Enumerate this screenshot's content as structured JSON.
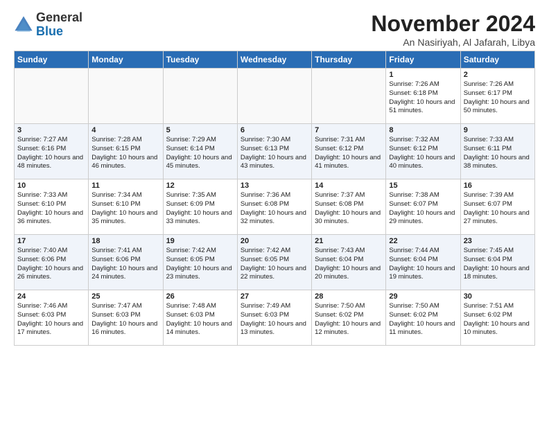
{
  "header": {
    "logo_general": "General",
    "logo_blue": "Blue",
    "month_title": "November 2024",
    "location": "An Nasiriyah, Al Jafarah, Libya"
  },
  "weekdays": [
    "Sunday",
    "Monday",
    "Tuesday",
    "Wednesday",
    "Thursday",
    "Friday",
    "Saturday"
  ],
  "weeks": [
    [
      {
        "day": "",
        "info": ""
      },
      {
        "day": "",
        "info": ""
      },
      {
        "day": "",
        "info": ""
      },
      {
        "day": "",
        "info": ""
      },
      {
        "day": "",
        "info": ""
      },
      {
        "day": "1",
        "info": "Sunrise: 7:26 AM\nSunset: 6:18 PM\nDaylight: 10 hours and 51 minutes."
      },
      {
        "day": "2",
        "info": "Sunrise: 7:26 AM\nSunset: 6:17 PM\nDaylight: 10 hours and 50 minutes."
      }
    ],
    [
      {
        "day": "3",
        "info": "Sunrise: 7:27 AM\nSunset: 6:16 PM\nDaylight: 10 hours and 48 minutes."
      },
      {
        "day": "4",
        "info": "Sunrise: 7:28 AM\nSunset: 6:15 PM\nDaylight: 10 hours and 46 minutes."
      },
      {
        "day": "5",
        "info": "Sunrise: 7:29 AM\nSunset: 6:14 PM\nDaylight: 10 hours and 45 minutes."
      },
      {
        "day": "6",
        "info": "Sunrise: 7:30 AM\nSunset: 6:13 PM\nDaylight: 10 hours and 43 minutes."
      },
      {
        "day": "7",
        "info": "Sunrise: 7:31 AM\nSunset: 6:12 PM\nDaylight: 10 hours and 41 minutes."
      },
      {
        "day": "8",
        "info": "Sunrise: 7:32 AM\nSunset: 6:12 PM\nDaylight: 10 hours and 40 minutes."
      },
      {
        "day": "9",
        "info": "Sunrise: 7:33 AM\nSunset: 6:11 PM\nDaylight: 10 hours and 38 minutes."
      }
    ],
    [
      {
        "day": "10",
        "info": "Sunrise: 7:33 AM\nSunset: 6:10 PM\nDaylight: 10 hours and 36 minutes."
      },
      {
        "day": "11",
        "info": "Sunrise: 7:34 AM\nSunset: 6:10 PM\nDaylight: 10 hours and 35 minutes."
      },
      {
        "day": "12",
        "info": "Sunrise: 7:35 AM\nSunset: 6:09 PM\nDaylight: 10 hours and 33 minutes."
      },
      {
        "day": "13",
        "info": "Sunrise: 7:36 AM\nSunset: 6:08 PM\nDaylight: 10 hours and 32 minutes."
      },
      {
        "day": "14",
        "info": "Sunrise: 7:37 AM\nSunset: 6:08 PM\nDaylight: 10 hours and 30 minutes."
      },
      {
        "day": "15",
        "info": "Sunrise: 7:38 AM\nSunset: 6:07 PM\nDaylight: 10 hours and 29 minutes."
      },
      {
        "day": "16",
        "info": "Sunrise: 7:39 AM\nSunset: 6:07 PM\nDaylight: 10 hours and 27 minutes."
      }
    ],
    [
      {
        "day": "17",
        "info": "Sunrise: 7:40 AM\nSunset: 6:06 PM\nDaylight: 10 hours and 26 minutes."
      },
      {
        "day": "18",
        "info": "Sunrise: 7:41 AM\nSunset: 6:06 PM\nDaylight: 10 hours and 24 minutes."
      },
      {
        "day": "19",
        "info": "Sunrise: 7:42 AM\nSunset: 6:05 PM\nDaylight: 10 hours and 23 minutes."
      },
      {
        "day": "20",
        "info": "Sunrise: 7:42 AM\nSunset: 6:05 PM\nDaylight: 10 hours and 22 minutes."
      },
      {
        "day": "21",
        "info": "Sunrise: 7:43 AM\nSunset: 6:04 PM\nDaylight: 10 hours and 20 minutes."
      },
      {
        "day": "22",
        "info": "Sunrise: 7:44 AM\nSunset: 6:04 PM\nDaylight: 10 hours and 19 minutes."
      },
      {
        "day": "23",
        "info": "Sunrise: 7:45 AM\nSunset: 6:04 PM\nDaylight: 10 hours and 18 minutes."
      }
    ],
    [
      {
        "day": "24",
        "info": "Sunrise: 7:46 AM\nSunset: 6:03 PM\nDaylight: 10 hours and 17 minutes."
      },
      {
        "day": "25",
        "info": "Sunrise: 7:47 AM\nSunset: 6:03 PM\nDaylight: 10 hours and 16 minutes."
      },
      {
        "day": "26",
        "info": "Sunrise: 7:48 AM\nSunset: 6:03 PM\nDaylight: 10 hours and 14 minutes."
      },
      {
        "day": "27",
        "info": "Sunrise: 7:49 AM\nSunset: 6:03 PM\nDaylight: 10 hours and 13 minutes."
      },
      {
        "day": "28",
        "info": "Sunrise: 7:50 AM\nSunset: 6:02 PM\nDaylight: 10 hours and 12 minutes."
      },
      {
        "day": "29",
        "info": "Sunrise: 7:50 AM\nSunset: 6:02 PM\nDaylight: 10 hours and 11 minutes."
      },
      {
        "day": "30",
        "info": "Sunrise: 7:51 AM\nSunset: 6:02 PM\nDaylight: 10 hours and 10 minutes."
      }
    ]
  ]
}
